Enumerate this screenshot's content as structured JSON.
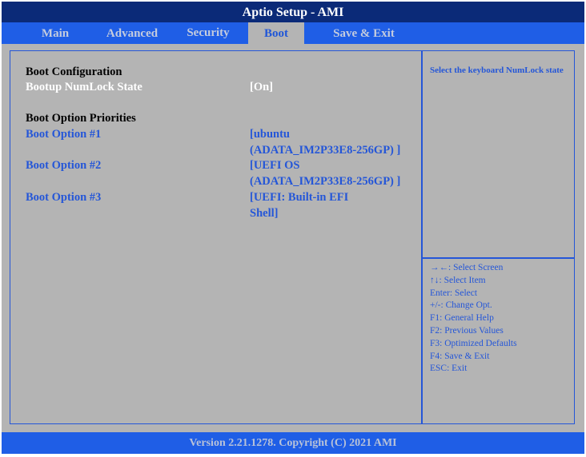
{
  "title": "Aptio Setup  - AMI",
  "tabs": [
    "Main",
    "Advanced",
    "Security",
    "Boot",
    "Save & Exit"
  ],
  "active_tab": "Boot",
  "main": {
    "boot_config_heading": "Boot Configuration",
    "numlock_label": "Bootup NumLock State",
    "numlock_value": "[On]",
    "priorities_heading": "Boot Option Priorities",
    "options": [
      {
        "label": "Boot Option #1",
        "value_line1": "[ubuntu",
        "value_line2": "(ADATA_IM2P33E8-256GP) ]"
      },
      {
        "label": "Boot Option #2",
        "value_line1": "[UEFI OS",
        "value_line2": "(ADATA_IM2P33E8-256GP) ]"
      },
      {
        "label": "Boot Option #3",
        "value_line1": "[UEFI: Built-in EFI",
        "value_line2": "Shell]"
      }
    ]
  },
  "help_text": "Select the keyboard NumLock state",
  "keys": [
    "→←: Select Screen",
    "↑↓: Select Item",
    "Enter: Select",
    "+/-: Change Opt.",
    "F1: General Help",
    "F2: Previous Values",
    "F3: Optimized Defaults",
    "F4: Save & Exit",
    "ESC: Exit"
  ],
  "footer": "Version 2.21.1278. Copyright (C) 2021 AMI"
}
